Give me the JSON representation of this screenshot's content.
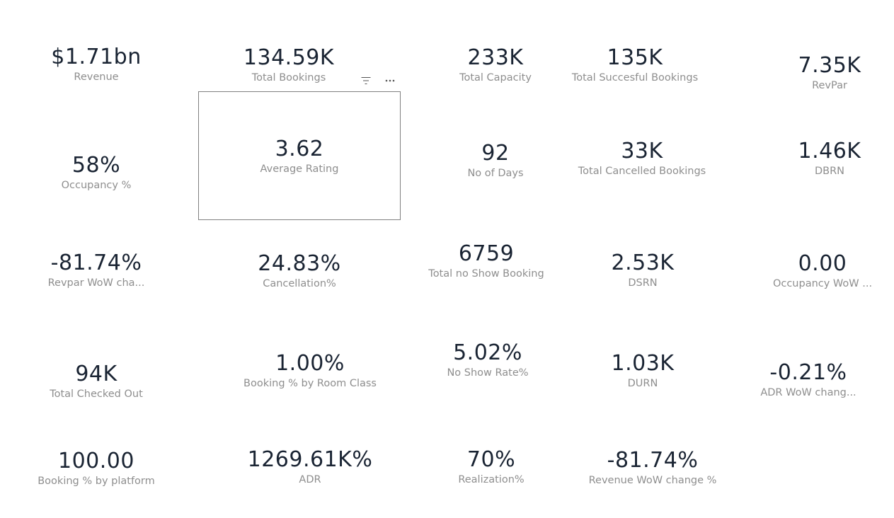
{
  "cards": {
    "revenue": {
      "value": "$1.71bn",
      "label": "Revenue"
    },
    "total_bookings": {
      "value": "134.59K",
      "label": "Total Bookings"
    },
    "total_capacity": {
      "value": "233K",
      "label": "Total Capacity"
    },
    "total_successful_bookings": {
      "value": "135K",
      "label": "Total Succesful Bookings"
    },
    "revpar": {
      "value": "7.35K",
      "label": "RevPar"
    },
    "occupancy": {
      "value": "58%",
      "label": "Occupancy %"
    },
    "average_rating": {
      "value": "3.62",
      "label": "Average Rating"
    },
    "no_of_days": {
      "value": "92",
      "label": "No of Days"
    },
    "total_cancelled_bookings": {
      "value": "33K",
      "label": "Total Cancelled Bookings"
    },
    "dbrn": {
      "value": "1.46K",
      "label": "DBRN"
    },
    "revpar_wow_change": {
      "value": "-81.74%",
      "label": "Revpar WoW cha..."
    },
    "cancellation": {
      "value": "24.83%",
      "label": "Cancellation%"
    },
    "total_no_show_booking": {
      "value": "6759",
      "label": "Total no Show Booking"
    },
    "dsrn": {
      "value": "2.53K",
      "label": "DSRN"
    },
    "occupancy_wow": {
      "value": "0.00",
      "label": "Occupancy WoW ..."
    },
    "total_checked_out": {
      "value": "94K",
      "label": "Total Checked Out"
    },
    "booking_by_room_class": {
      "value": "1.00%",
      "label": "Booking % by Room Class"
    },
    "no_show_rate": {
      "value": "5.02%",
      "label": "No Show Rate%"
    },
    "durn": {
      "value": "1.03K",
      "label": "DURN"
    },
    "adr_wow_change": {
      "value": "-0.21%",
      "label": "ADR WoW chang..."
    },
    "booking_by_platform": {
      "value": "100.00",
      "label": "Booking % by platform"
    },
    "adr": {
      "value": "1269.61K%",
      "label": "ADR"
    },
    "realization": {
      "value": "70%",
      "label": "Realization%"
    },
    "revenue_wow_change": {
      "value": "-81.74%",
      "label": "Revenue WoW change %"
    }
  },
  "visual_header": {
    "filter_icon": "filter-icon",
    "more_icon": "more-options-icon"
  }
}
